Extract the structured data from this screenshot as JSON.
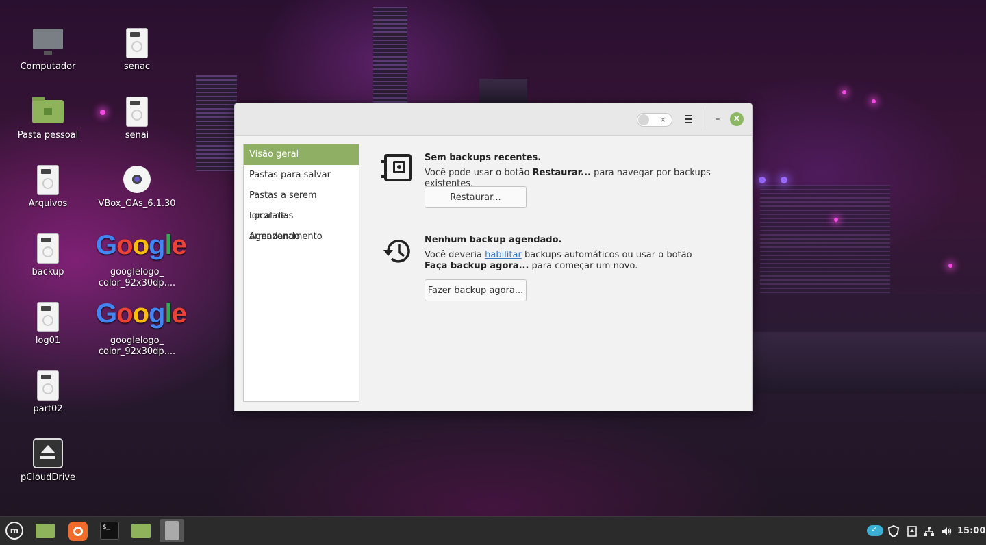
{
  "desktop": {
    "icons": [
      {
        "label": "Computador",
        "type": "computer"
      },
      {
        "label": "senac",
        "type": "drive"
      },
      {
        "label": "Pasta pessoal",
        "type": "home-folder"
      },
      {
        "label": "senai",
        "type": "drive"
      },
      {
        "label": "Arquivos",
        "type": "drive"
      },
      {
        "label": "VBox_GAs_6.1.30",
        "type": "disc"
      },
      {
        "label": "backup",
        "type": "drive"
      },
      {
        "label": "googlelogo_\ncolor_92x30dp....",
        "type": "google"
      },
      {
        "label": "log01",
        "type": "drive"
      },
      {
        "label": "googlelogo_\ncolor_92x30dp....",
        "type": "google"
      },
      {
        "label": "part02",
        "type": "drive"
      },
      {
        "label": "pCloudDrive",
        "type": "eject"
      }
    ],
    "google_text": [
      "G",
      "o",
      "o",
      "g",
      "l",
      "e"
    ]
  },
  "window": {
    "sidebar": {
      "items": [
        {
          "label": "Visão geral",
          "active": true
        },
        {
          "label": "Pastas para salvar",
          "active": false
        },
        {
          "label": "Pastas a serem ignoradas",
          "active": false
        },
        {
          "label": "Local de armazenamento",
          "active": false
        },
        {
          "label": "Agendando",
          "active": false
        }
      ]
    },
    "restore_section": {
      "title": "Sem backups recentes.",
      "text_before": "Você pode usar o botão ",
      "text_bold": "Restaurar...",
      "text_after": " para navegar por backups existentes.",
      "button": "Restaurar..."
    },
    "schedule_section": {
      "title": "Nenhum backup agendado.",
      "text_before": "Você deveria ",
      "link": "habilitar",
      "text_middle": " backups automáticos ou usar o botão ",
      "text_bold": "Faça backup agora...",
      "text_after": " para começar um novo.",
      "button": "Fazer backup agora..."
    },
    "titlebar": {
      "toggle_state": "off",
      "toggle_x": "×",
      "minimize": "–",
      "close": "×"
    }
  },
  "taskbar": {
    "terminal_text": "$_",
    "clock": "15:00",
    "colors": {
      "accent": "#8fb064",
      "close": "#8cb865",
      "link": "#3a7ac8"
    }
  }
}
